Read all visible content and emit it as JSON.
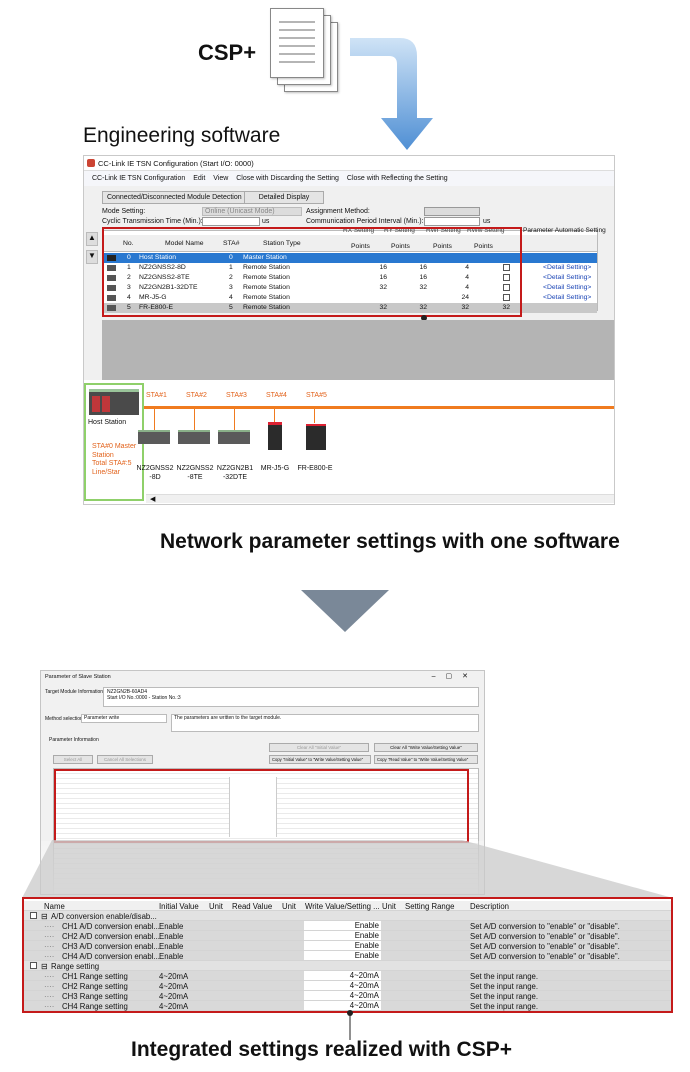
{
  "top": {
    "csp_label": "CSP+",
    "eng_label": "Engineering software"
  },
  "app": {
    "title": "CC-Link IE TSN Configuration (Start I/O: 0000)",
    "menu": [
      "CC-Link IE TSN Configuration",
      "Edit",
      "View",
      "Close with Discarding the Setting",
      "Close with Reflecting the Setting"
    ],
    "tabs": [
      "Connected/Disconnected Module Detection",
      "Detailed Display"
    ],
    "mode_label": "Mode Setting:",
    "mode_value": "Online (Unicast Mode)",
    "assign_label": "Assignment Method:",
    "cyclic_label": "Cyclic Transmission Time (Min.):",
    "cyclic_unit": "us",
    "comm_label": "Communication Period Interval (Min.):",
    "comm_unit": "us",
    "headers_top": [
      "RX Setting",
      "RY Setting",
      "RWr Setting",
      "RWw Setting",
      "Parameter Automatic Setting"
    ],
    "headers": [
      "No.",
      "Model Name",
      "STA#",
      "Station Type",
      "Points",
      "Points",
      "Points",
      "Points"
    ],
    "rows": [
      {
        "no": "0",
        "model": "Host Station",
        "sta": "0",
        "type": "Master Station",
        "rx": "",
        "ry": "",
        "rwr": "",
        "rww": "",
        "detail": ""
      },
      {
        "no": "1",
        "model": "NZ2GNSS2-8D",
        "sta": "1",
        "type": "Remote Station",
        "rx": "16",
        "ry": "16",
        "rwr": "4",
        "rww": "4",
        "detail": "<Detail Setting>"
      },
      {
        "no": "2",
        "model": "NZ2GNSS2-8TE",
        "sta": "2",
        "type": "Remote Station",
        "rx": "16",
        "ry": "16",
        "rwr": "4",
        "rww": "4",
        "detail": "<Detail Setting>"
      },
      {
        "no": "3",
        "model": "NZ2GN2B1-32DTE",
        "sta": "3",
        "type": "Remote Station",
        "rx": "32",
        "ry": "32",
        "rwr": "4",
        "rww": "4",
        "detail": "<Detail Setting>"
      },
      {
        "no": "4",
        "model": "MR-J5-G",
        "sta": "4",
        "type": "Remote Station",
        "rx": "",
        "ry": "",
        "rwr": "24",
        "rww": "20",
        "detail": "<Detail Setting>"
      },
      {
        "no": "5",
        "model": "FR-E800-E",
        "sta": "5",
        "type": "Remote Station",
        "rx": "32",
        "ry": "32",
        "rwr": "32",
        "rww": "32",
        "detail": ""
      }
    ],
    "host_label": "Host Station",
    "host_info": [
      "STA#0 Master",
      "Station",
      "Total STA#:5",
      "Line/Star"
    ],
    "stations": [
      "STA#1",
      "STA#2",
      "STA#3",
      "STA#4",
      "STA#5"
    ],
    "devices": [
      [
        "NZ2GNSS2",
        "-8D"
      ],
      [
        "NZ2GNSS2",
        "-8TE"
      ],
      [
        "NZ2GN2B1",
        "-32DTE"
      ],
      [
        "MR-J5-G",
        ""
      ],
      [
        "FR-E800-E",
        ""
      ]
    ]
  },
  "caption1": "Network parameter settings with one software",
  "param": {
    "title": "Parameter of Slave Station",
    "target_label": "Target Module Information:",
    "target_value": [
      "NZ2GN2B-60AD4",
      "Start I/O No.:0000 - Station No.:3"
    ],
    "method_label": "Method selection:",
    "method_value": "Parameter write",
    "method_desc": "The parameters are written to the target module.",
    "info_label": "Parameter Information",
    "btns": [
      "Select All",
      "Cancel All Selections",
      "Clear All \"Initial Value\"",
      "Clear All \"Write Value/Setting Value\"",
      "Copy \"Initial Value\" to \"Write Value/Setting Value\"",
      "Copy \"Read Value\" to \"Write Value/Setting Value\""
    ]
  },
  "zoom": {
    "headers": [
      "Name",
      "Initial Value",
      "Unit",
      "Read Value",
      "Unit",
      "Write Value/Setting ...",
      "Unit",
      "Setting Range",
      "Description"
    ],
    "rows": [
      {
        "name": "A/D conversion enable/disab...",
        "init": "",
        "write": "",
        "desc": "",
        "group": true
      },
      {
        "name": "CH1 A/D conversion enabl...",
        "init": "Enable",
        "write": "Enable",
        "desc": "Set A/D conversion to \"enable\" or \"disable\".",
        "group": false
      },
      {
        "name": "CH2 A/D conversion enabl...",
        "init": "Enable",
        "write": "Enable",
        "desc": "Set A/D conversion to \"enable\" or \"disable\".",
        "group": false
      },
      {
        "name": "CH3 A/D conversion enabl...",
        "init": "Enable",
        "write": "Enable",
        "desc": "Set A/D conversion to \"enable\" or \"disable\".",
        "group": false
      },
      {
        "name": "CH4 A/D conversion enabl...",
        "init": "Enable",
        "write": "Enable",
        "desc": "Set A/D conversion to \"enable\" or \"disable\".",
        "group": false
      },
      {
        "name": "Range setting",
        "init": "",
        "write": "",
        "desc": "",
        "group": true
      },
      {
        "name": "CH1 Range setting",
        "init": "4~20mA",
        "write": "4~20mA",
        "desc": "Set the input range.",
        "group": false
      },
      {
        "name": "CH2 Range setting",
        "init": "4~20mA",
        "write": "4~20mA",
        "desc": "Set the input range.",
        "group": false
      },
      {
        "name": "CH3 Range setting",
        "init": "4~20mA",
        "write": "4~20mA",
        "desc": "Set the input range.",
        "group": false
      },
      {
        "name": "CH4 Range setting",
        "init": "4~20mA",
        "write": "4~20mA",
        "desc": "Set the input range.",
        "group": false
      }
    ]
  },
  "caption2": "Integrated settings realized with CSP+"
}
